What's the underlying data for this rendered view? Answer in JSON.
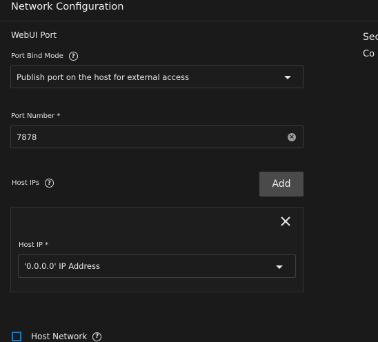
{
  "section_title": "Network Configuration",
  "webui_port": {
    "title": "WebUI Port",
    "bind_mode": {
      "label": "Port Bind Mode",
      "value": "Publish port on the host for external access"
    },
    "port_number": {
      "label": "Port Number *",
      "value": "7878"
    },
    "host_ips": {
      "label": "Host IPs",
      "add_label": "Add",
      "item": {
        "label": "Host IP *",
        "value": "'0.0.0.0' IP Address"
      }
    }
  },
  "host_network": {
    "label": "Host Network",
    "checked": false
  },
  "side_panel": {
    "heading_fragment": "Sec",
    "text_fragment": "Co"
  },
  "icons": {
    "help": "help-circle-icon",
    "dropdown": "chevron-down-icon",
    "clear": "clear-icon",
    "close": "close-icon"
  },
  "colors": {
    "background": "#1a1a1a",
    "checkbox_accent": "#1f7bbf",
    "button_bg": "#4a4a4a"
  }
}
